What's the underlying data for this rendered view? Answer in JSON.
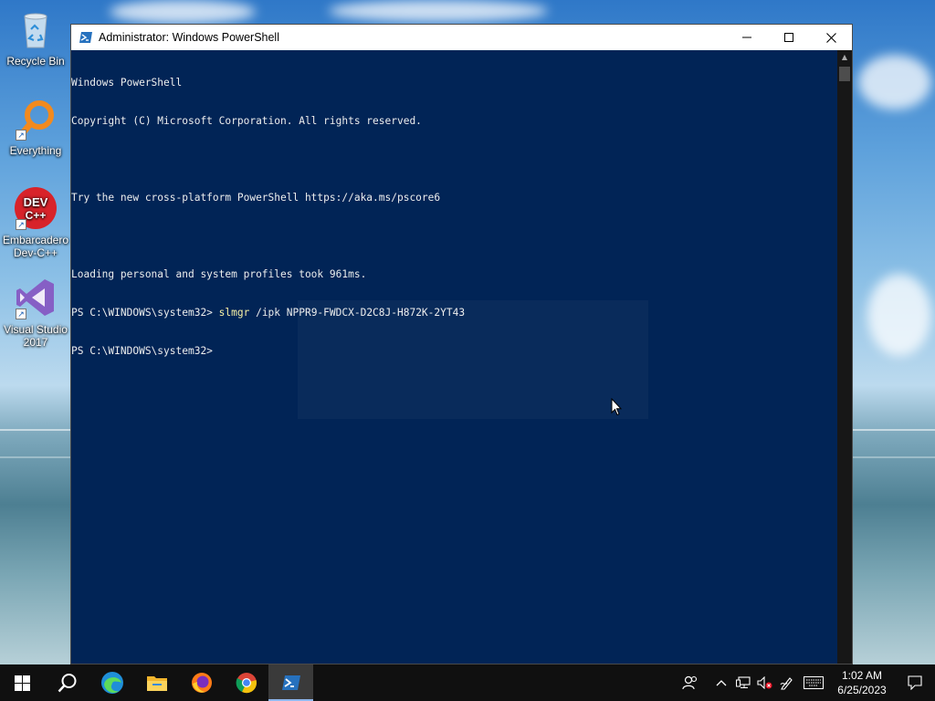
{
  "desktop": {
    "icons": [
      {
        "label": "Recycle Bin",
        "icon": "recycle-bin-icon"
      },
      {
        "label": "Everything",
        "icon": "everything-search-icon"
      },
      {
        "label": "Embarcadero Dev-C++",
        "icon": "devcpp-icon",
        "badge_text": "DEV C++"
      },
      {
        "label": "Visual Studio 2017",
        "icon": "visual-studio-icon"
      }
    ]
  },
  "window": {
    "title": "Administrator: Windows PowerShell",
    "controls": {
      "minimize": "—",
      "maximize": "☐",
      "close": "✕"
    }
  },
  "console": {
    "lines": [
      "Windows PowerShell",
      "Copyright (C) Microsoft Corporation. All rights reserved.",
      "",
      "Try the new cross-platform PowerShell https://aka.ms/pscore6",
      "",
      "Loading personal and system profiles took 961ms."
    ],
    "prompt": "PS C:\\WINDOWS\\system32> ",
    "command_name": "slmgr",
    "command_args": " /ipk NPPR9-FWDCX-D2C8J-H872K-2YT43",
    "prompt2": "PS C:\\WINDOWS\\system32>"
  },
  "taskbar": {
    "apps": [
      "start-icon",
      "search-icon",
      "edge-icon",
      "file-explorer-icon",
      "firefox-icon",
      "chrome-icon",
      "powershell-icon"
    ],
    "active_app": "powershell-icon",
    "clock": {
      "time": "1:02 AM",
      "date": "6/25/2023"
    }
  },
  "colors": {
    "console_bg": "#012456",
    "console_fg": "#ededed",
    "command_highlight": "#f9f1a5",
    "taskbar_bg": "#101010"
  }
}
